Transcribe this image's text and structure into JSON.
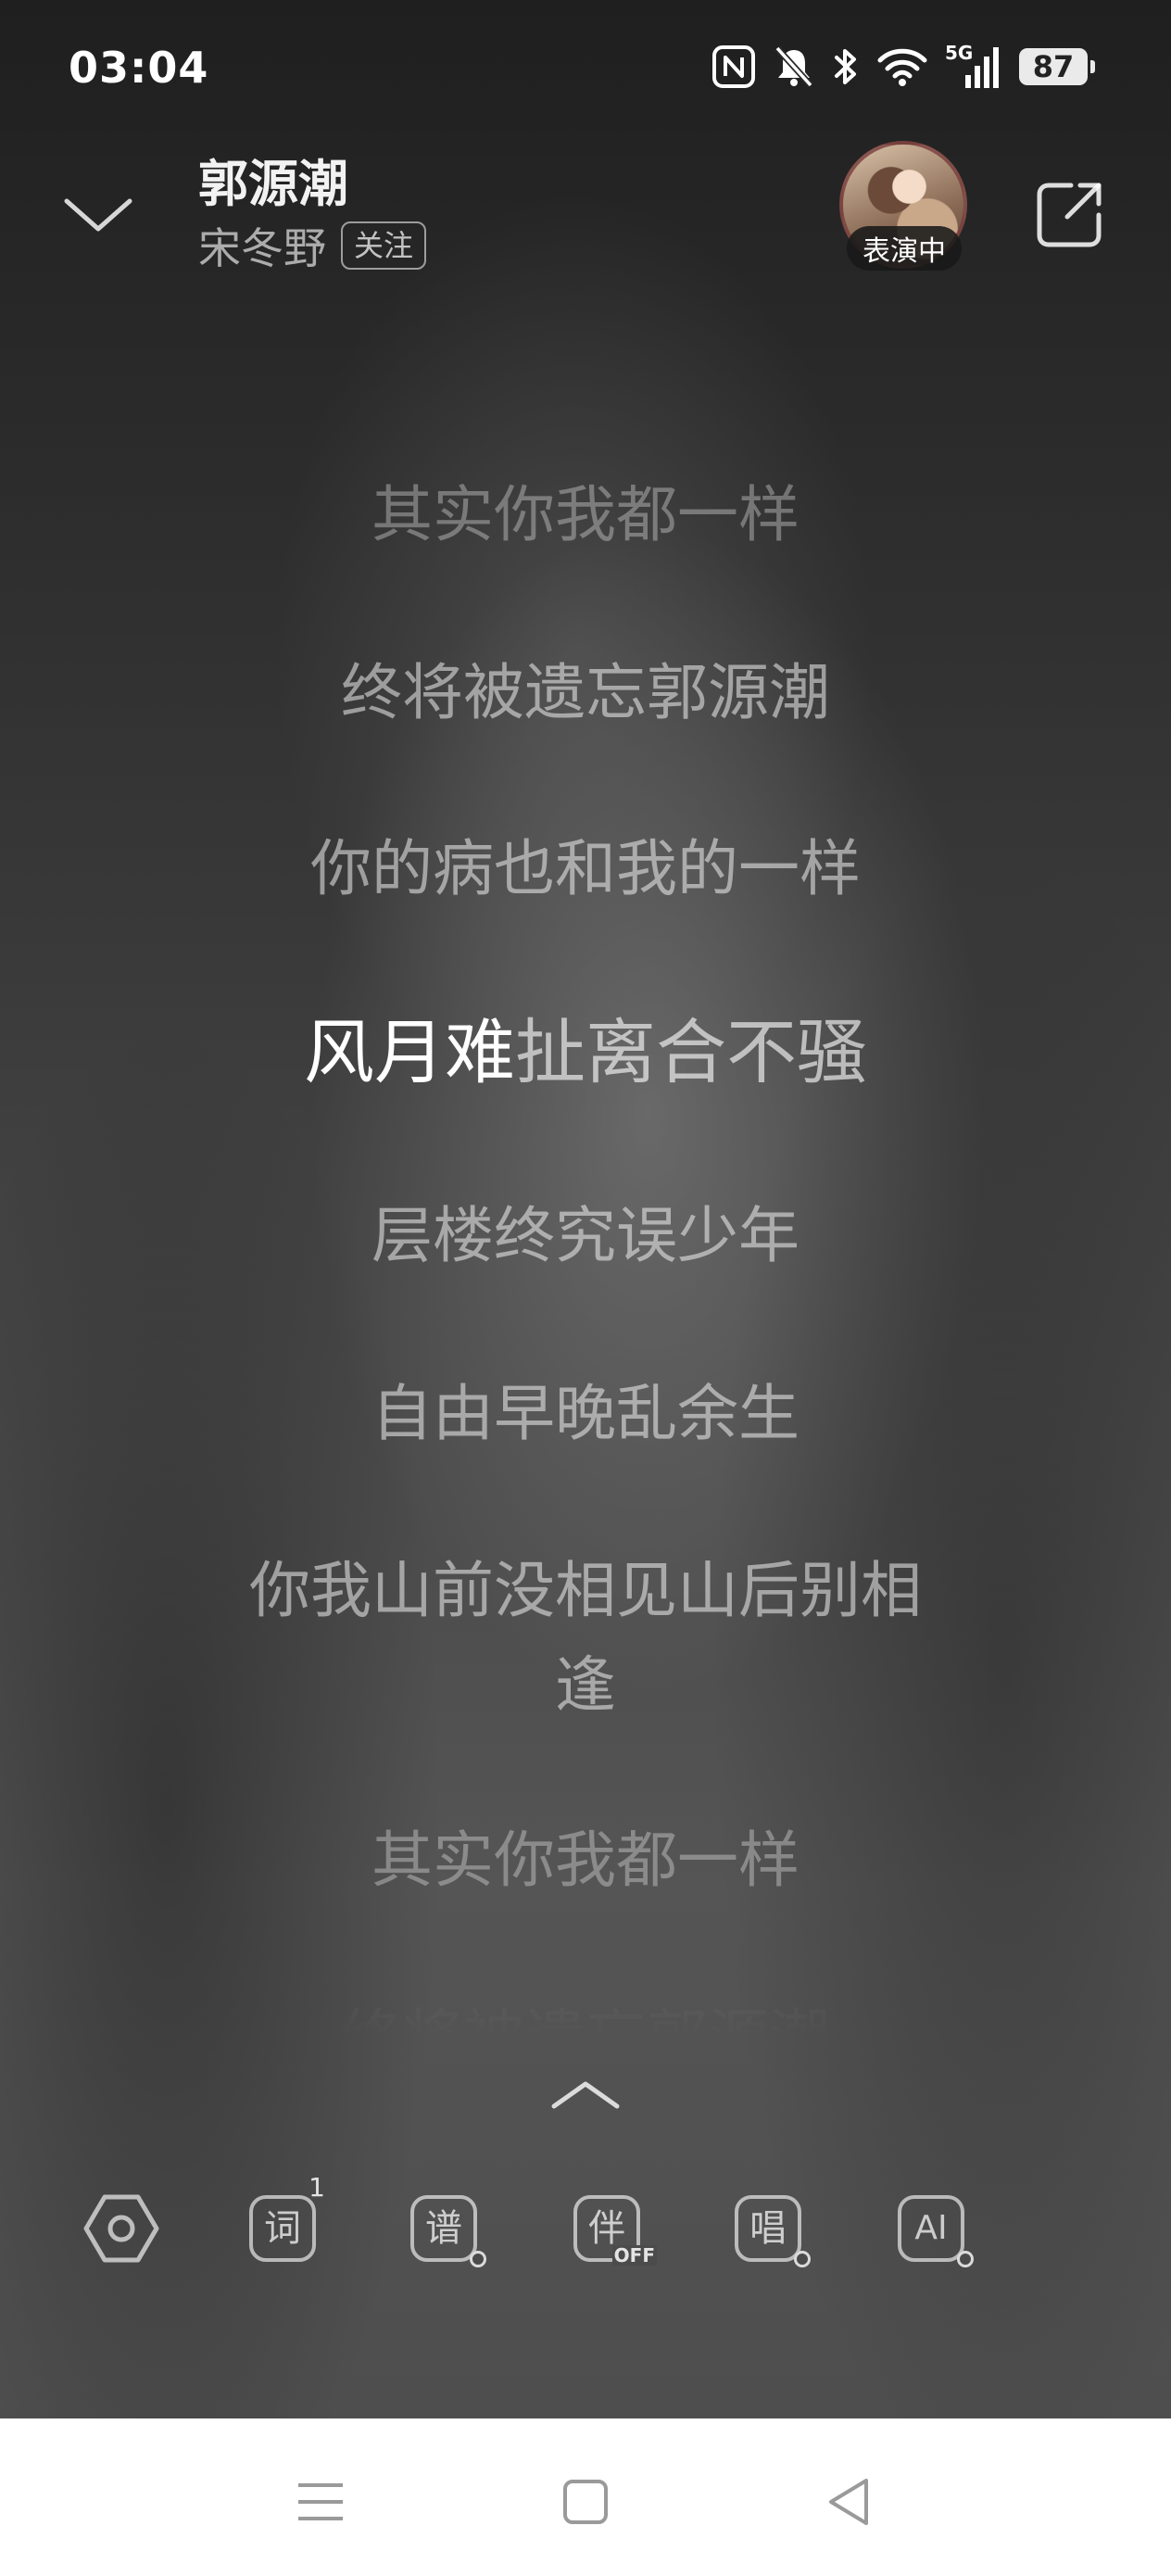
{
  "status_bar": {
    "time": "03:04",
    "network": "5G",
    "battery": "87",
    "icons": [
      "nfc-icon",
      "mute-bell-icon",
      "bluetooth-icon",
      "wifi-icon",
      "signal-icon",
      "battery-icon"
    ]
  },
  "header": {
    "song_title": "郭源潮",
    "artist": "宋冬野",
    "follow_label": "关注",
    "performing_badge": "表演中"
  },
  "lyrics": {
    "lines": [
      "其实你我都一样",
      "终将被遗忘郭源潮",
      "你的病也和我的一样",
      "风月难扯离合不骚",
      "层楼终究误少年",
      "自由早晚乱余生",
      "你我山前没相见山后别相逢",
      "其实你我都一样",
      "终将被遗忘郭源潮"
    ],
    "current_index": 3,
    "current_sung": "风月难",
    "current_unsung": "扯离合不骚",
    "wrapped_line_part1": "你我山前没相见山后别相",
    "wrapped_line_part2": "逢"
  },
  "toolbar": {
    "lyrics_label": "词",
    "lyrics_count": "1",
    "score_label": "谱",
    "accompany_label": "伴",
    "accompany_state": "OFF",
    "sing_label": "唱",
    "ai_label": "AI"
  },
  "colors": {
    "text_primary": "#ffffff",
    "nav_background": "#ffffff",
    "background_dark": "#2b2b2b"
  }
}
